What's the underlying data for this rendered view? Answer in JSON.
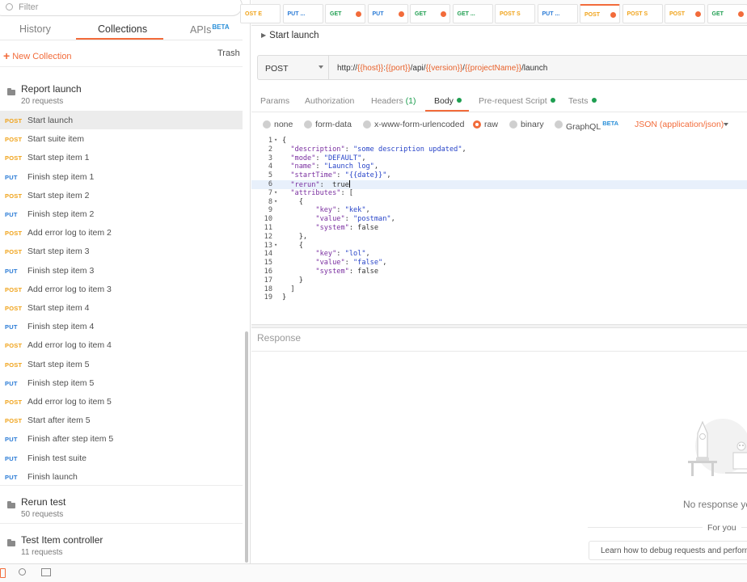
{
  "sidebar": {
    "filter_placeholder": "Filter",
    "tabs": {
      "history": "History",
      "collections": "Collections",
      "apis": "APIs",
      "apis_badge": "BETA"
    },
    "new_collection": "New Collection",
    "trash": "Trash",
    "collections": [
      {
        "name": "Report launch",
        "count": "20 requests"
      },
      {
        "name": "Rerun test",
        "count": "50 requests"
      },
      {
        "name": "Test Item controller",
        "count": "11 requests"
      }
    ],
    "requests": [
      {
        "method": "POST",
        "name": "Start launch"
      },
      {
        "method": "POST",
        "name": "Start suite item"
      },
      {
        "method": "POST",
        "name": "Start step item 1"
      },
      {
        "method": "PUT",
        "name": "Finish step item 1"
      },
      {
        "method": "POST",
        "name": "Start step item 2"
      },
      {
        "method": "PUT",
        "name": "Finish step item 2"
      },
      {
        "method": "POST",
        "name": "Add error log to item 2"
      },
      {
        "method": "POST",
        "name": "Start step item 3"
      },
      {
        "method": "PUT",
        "name": "Finish step item 3"
      },
      {
        "method": "POST",
        "name": "Add error log to item 3"
      },
      {
        "method": "POST",
        "name": "Start step item 4"
      },
      {
        "method": "PUT",
        "name": "Finish step item 4"
      },
      {
        "method": "POST",
        "name": "Add error log to item 4"
      },
      {
        "method": "POST",
        "name": "Start step item 5"
      },
      {
        "method": "PUT",
        "name": "Finish step item 5"
      },
      {
        "method": "POST",
        "name": "Add error log to item 5"
      },
      {
        "method": "POST",
        "name": "Start after item 5"
      },
      {
        "method": "PUT",
        "name": "Finish after step item 5"
      },
      {
        "method": "PUT",
        "name": "Finish test suite"
      },
      {
        "method": "PUT",
        "name": "Finish launch"
      }
    ]
  },
  "request_tabs": [
    {
      "label": "OST E",
      "method": "POST",
      "dot": false
    },
    {
      "label": "PUT ...",
      "method": "PUT",
      "dot": false
    },
    {
      "label": "GET",
      "method": "GET",
      "dot": true
    },
    {
      "label": "PUT",
      "method": "PUT",
      "dot": true
    },
    {
      "label": "GET",
      "method": "GET",
      "dot": true
    },
    {
      "label": "GET ...",
      "method": "GET",
      "dot": false
    },
    {
      "label": "POST S",
      "method": "POST",
      "dot": false
    },
    {
      "label": "PUT ...",
      "method": "PUT",
      "dot": false
    },
    {
      "label": "POST",
      "method": "POST",
      "dot": true,
      "active": true
    },
    {
      "label": "POST S",
      "method": "POST",
      "dot": false
    },
    {
      "label": "POST",
      "method": "POST",
      "dot": true
    },
    {
      "label": "GET",
      "method": "GET",
      "dot": true
    }
  ],
  "request": {
    "title": "Start launch",
    "method": "POST",
    "url_parts": [
      {
        "t": "http://",
        "v": false
      },
      {
        "t": "{{host}}",
        "v": true
      },
      {
        "t": ":",
        "v": false
      },
      {
        "t": "{{port}}",
        "v": true
      },
      {
        "t": "/api/",
        "v": false
      },
      {
        "t": "{{version}}",
        "v": true
      },
      {
        "t": "/",
        "v": false
      },
      {
        "t": "{{projectName}}",
        "v": true
      },
      {
        "t": "/launch",
        "v": false
      }
    ]
  },
  "subtabs": {
    "params": "Params",
    "authorization": "Authorization",
    "headers": "Headers",
    "headers_count": "(1)",
    "body": "Body",
    "prerequest": "Pre-request Script",
    "tests": "Tests"
  },
  "body_options": {
    "none": "none",
    "formdata": "form-data",
    "urlencoded": "x-www-form-urlencoded",
    "raw": "raw",
    "binary": "binary",
    "graphql": "GraphQL",
    "graphql_badge": "BETA",
    "format": "JSON (application/json)"
  },
  "editor_lines": [
    {
      "n": "1",
      "fold": "▾",
      "code": "{"
    },
    {
      "n": "2",
      "fold": "",
      "code": "  \"description\": \"some description updated\","
    },
    {
      "n": "3",
      "fold": "",
      "code": "  \"mode\": \"DEFAULT\","
    },
    {
      "n": "4",
      "fold": "",
      "code": "  \"name\": \"Launch log\","
    },
    {
      "n": "5",
      "fold": "",
      "code": "  \"startTime\": \"{{date}}\","
    },
    {
      "n": "6",
      "fold": "",
      "code": "  \"rerun\":  true",
      "current": true
    },
    {
      "n": "7",
      "fold": "▾",
      "code": "  \"attributes\": ["
    },
    {
      "n": "8",
      "fold": "▾",
      "code": "    {"
    },
    {
      "n": "9",
      "fold": "",
      "code": "        \"key\": \"kek\","
    },
    {
      "n": "10",
      "fold": "",
      "code": "        \"value\": \"postman\","
    },
    {
      "n": "11",
      "fold": "",
      "code": "        \"system\": false"
    },
    {
      "n": "12",
      "fold": "",
      "code": "    },"
    },
    {
      "n": "13",
      "fold": "▾",
      "code": "    {"
    },
    {
      "n": "14",
      "fold": "",
      "code": "        \"key\": \"lol\","
    },
    {
      "n": "15",
      "fold": "",
      "code": "        \"value\": \"false\","
    },
    {
      "n": "16",
      "fold": "",
      "code": "        \"system\": false"
    },
    {
      "n": "17",
      "fold": "",
      "code": "    }"
    },
    {
      "n": "18",
      "fold": "",
      "code": "  ]"
    },
    {
      "n": "19",
      "fold": "",
      "code": "}"
    }
  ],
  "response": {
    "title": "Response",
    "empty": "No response ye",
    "for_you": "For you",
    "learn": "Learn how to debug requests and perform"
  },
  "colors": {
    "accent": "#f26b3a",
    "post": "#f0a31a",
    "put": "#2a7bd6",
    "get": "#1e9e50"
  },
  "icons": {
    "bottom": [
      "sidebar-toggle-icon",
      "find-icon",
      "console-icon"
    ],
    "folder": "folder-icon",
    "search": "search-icon"
  }
}
